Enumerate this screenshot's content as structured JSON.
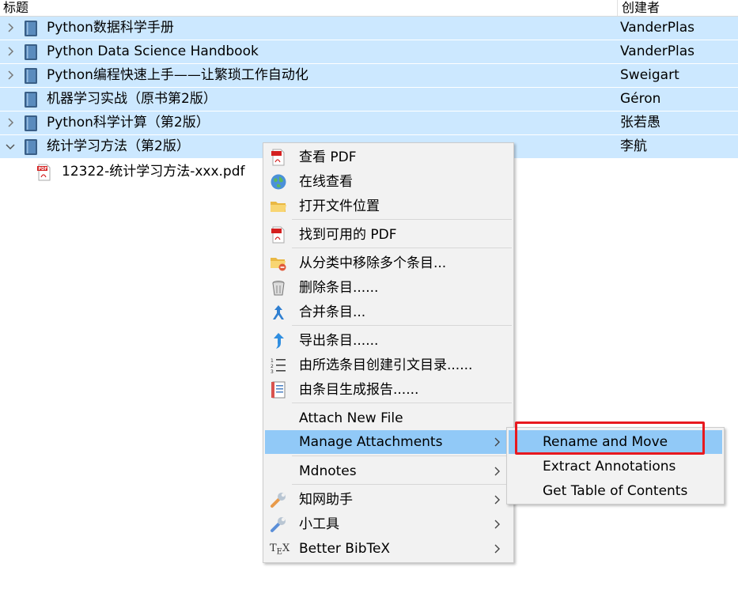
{
  "columns": {
    "title": "标题",
    "creator": "创建者"
  },
  "rows": [
    {
      "title": "Python数据科学手册",
      "creator": "VanderPlas",
      "expanded": false
    },
    {
      "title": "Python Data Science Handbook",
      "creator": "VanderPlas",
      "expanded": false
    },
    {
      "title": "Python编程快速上手——让繁琐工作自动化",
      "creator": "Sweigart",
      "expanded": false
    },
    {
      "title": "机器学习实战（原书第2版）",
      "creator": "Géron",
      "expanded": false
    },
    {
      "title": "Python科学计算（第2版）",
      "creator": "张若愚",
      "expanded": false
    },
    {
      "title": "统计学习方法（第2版）",
      "creator": "李航",
      "expanded": true
    }
  ],
  "attachment": {
    "title": "12322-统计学习方法-xxx.pdf",
    "icon": "pdf-icon"
  },
  "context_menu": {
    "items": [
      {
        "label": "查看 PDF",
        "icon": "pdf-icon"
      },
      {
        "label": "在线查看",
        "icon": "globe-icon"
      },
      {
        "label": "打开文件位置",
        "icon": "folder-icon"
      },
      {
        "label": "找到可用的 PDF",
        "icon": "pdf-icon"
      },
      {
        "label": "从分类中移除多个条目...",
        "icon": "folder-remove-icon"
      },
      {
        "label": "删除条目......",
        "icon": "trash-icon"
      },
      {
        "label": "合并条目...",
        "icon": "merge-icon"
      },
      {
        "label": "导出条目......",
        "icon": "export-icon"
      },
      {
        "label": "由所选条目创建引文目录......",
        "icon": "bibliography-icon"
      },
      {
        "label": "由条目生成报告......",
        "icon": "report-icon"
      },
      {
        "label": "Attach New File",
        "icon": ""
      },
      {
        "label": "Manage Attachments",
        "icon": "",
        "submenu": true,
        "highlighted": true
      },
      {
        "label": "Mdnotes",
        "icon": "",
        "submenu": true
      },
      {
        "label": "知网助手",
        "icon": "wrench-icon",
        "submenu": true
      },
      {
        "label": "小工具",
        "icon": "wrench-icon",
        "submenu": true
      },
      {
        "label": "Better BibTeX",
        "icon": "tex-icon",
        "submenu": true
      }
    ]
  },
  "submenu": {
    "items": [
      {
        "label": "Rename and Move",
        "highlighted": true
      },
      {
        "label": "Extract Annotations"
      },
      {
        "label": "Get Table of Contents"
      }
    ]
  },
  "colors": {
    "selection": "#cce8ff",
    "menu_highlight": "#91c9f7",
    "annotation_box": "#e8191f"
  }
}
